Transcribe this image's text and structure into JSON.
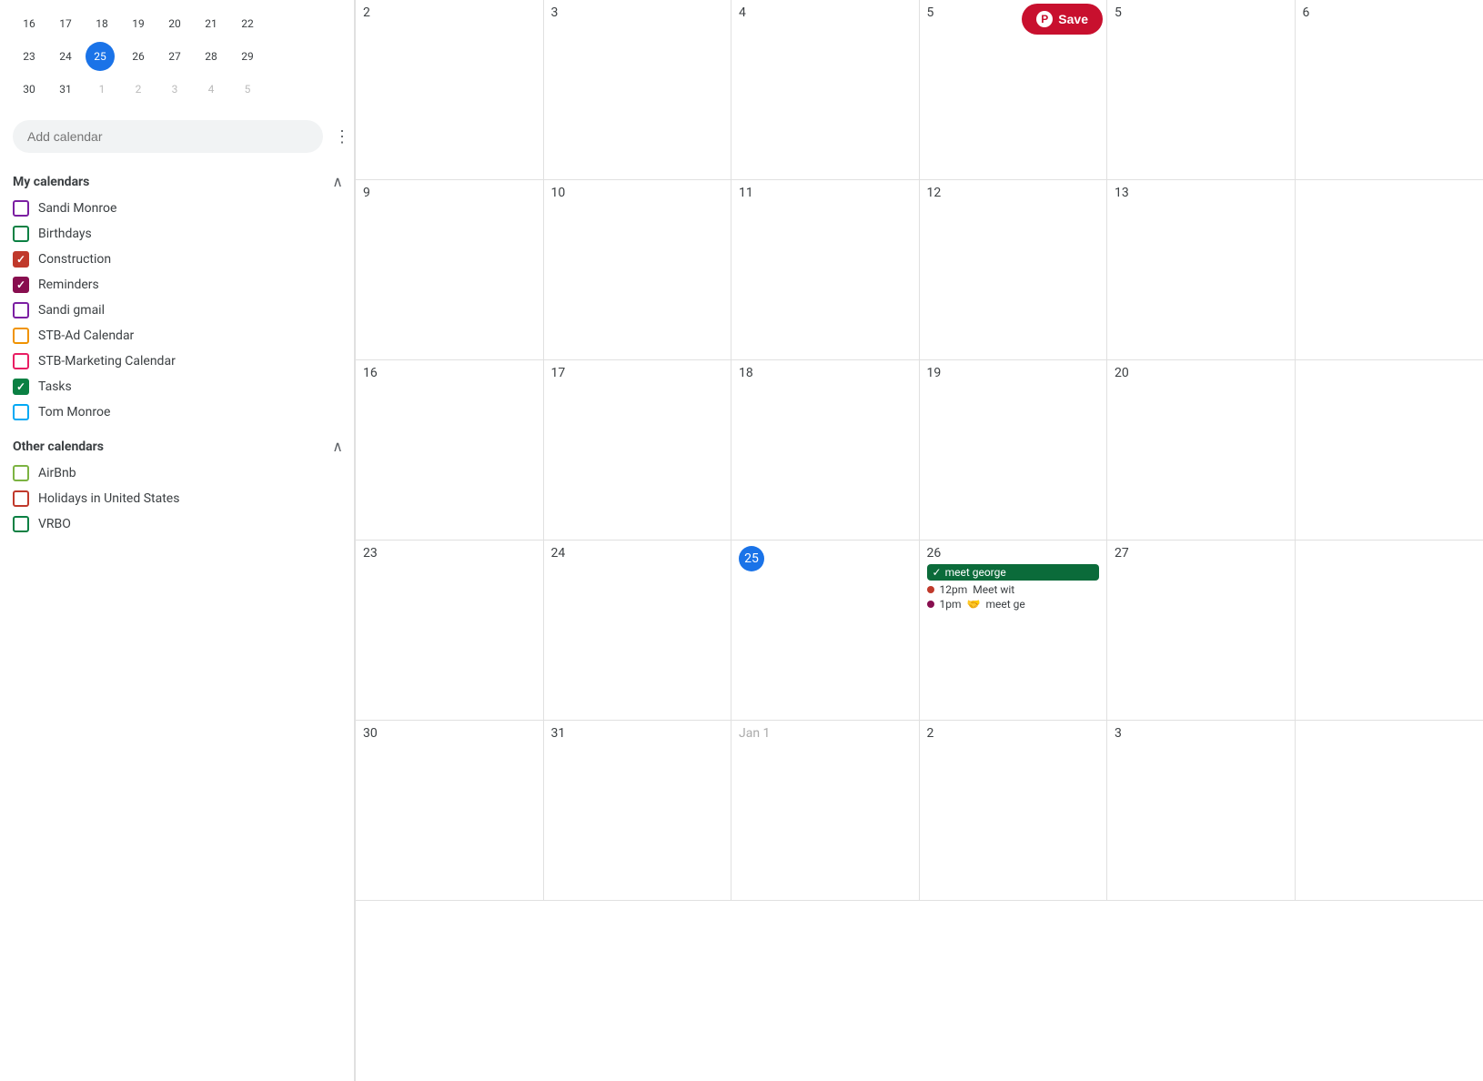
{
  "sidebar": {
    "mini_calendar": {
      "rows": [
        [
          {
            "date": "16",
            "type": "normal"
          },
          {
            "date": "17",
            "type": "normal"
          },
          {
            "date": "18",
            "type": "normal"
          },
          {
            "date": "19",
            "type": "normal"
          },
          {
            "date": "20",
            "type": "normal"
          },
          {
            "date": "21",
            "type": "normal"
          },
          {
            "date": "22",
            "type": "normal"
          }
        ],
        [
          {
            "date": "23",
            "type": "normal"
          },
          {
            "date": "24",
            "type": "normal"
          },
          {
            "date": "25",
            "type": "today"
          },
          {
            "date": "26",
            "type": "normal"
          },
          {
            "date": "27",
            "type": "normal"
          },
          {
            "date": "28",
            "type": "normal"
          },
          {
            "date": "29",
            "type": "normal"
          }
        ],
        [
          {
            "date": "30",
            "type": "normal"
          },
          {
            "date": "31",
            "type": "normal"
          },
          {
            "date": "1",
            "type": "other"
          },
          {
            "date": "2",
            "type": "other"
          },
          {
            "date": "3",
            "type": "other"
          },
          {
            "date": "4",
            "type": "other"
          },
          {
            "date": "5",
            "type": "other"
          }
        ]
      ]
    },
    "add_calendar_placeholder": "Add calendar",
    "my_calendars": {
      "title": "My calendars",
      "items": [
        {
          "label": "Sandi Monroe",
          "checked": false,
          "color": "#7b1fa2"
        },
        {
          "label": "Birthdays",
          "checked": false,
          "color": "#0b8043"
        },
        {
          "label": "Construction",
          "checked": true,
          "color": "#c0392b"
        },
        {
          "label": "Reminders",
          "checked": true,
          "color": "#880e4f"
        },
        {
          "label": "Sandi gmail",
          "checked": false,
          "color": "#7b1fa2"
        },
        {
          "label": "STB-Ad Calendar",
          "checked": false,
          "color": "#f09300"
        },
        {
          "label": "STB-Marketing Calendar",
          "checked": false,
          "color": "#e91e63"
        },
        {
          "label": "Tasks",
          "checked": true,
          "color": "#0b8043"
        },
        {
          "label": "Tom Monroe",
          "checked": false,
          "color": "#03a9f4"
        }
      ]
    },
    "other_calendars": {
      "title": "Other calendars",
      "items": [
        {
          "label": "AirBnb",
          "checked": false,
          "color": "#7cb342"
        },
        {
          "label": "Holidays in United States",
          "checked": false,
          "color": "#c0392b"
        },
        {
          "label": "VRBO",
          "checked": false,
          "color": "#0b8043"
        }
      ]
    }
  },
  "calendar": {
    "save_button_label": "Save",
    "cells": [
      {
        "row": 1,
        "col": 1,
        "date": "2",
        "type": "normal",
        "events": []
      },
      {
        "row": 1,
        "col": 2,
        "date": "3",
        "type": "normal",
        "events": []
      },
      {
        "row": 1,
        "col": 3,
        "date": "4",
        "type": "normal",
        "events": []
      },
      {
        "row": 1,
        "col": 4,
        "date": "5",
        "type": "normal",
        "has_save": true,
        "events": []
      },
      {
        "row": 1,
        "col": 5,
        "date": "5",
        "type": "normal",
        "events": []
      },
      {
        "row": 1,
        "col": 6,
        "date": "6",
        "type": "normal",
        "events": []
      },
      {
        "row": 2,
        "col": 1,
        "date": "9",
        "type": "normal",
        "events": []
      },
      {
        "row": 2,
        "col": 2,
        "date": "10",
        "type": "normal",
        "events": []
      },
      {
        "row": 2,
        "col": 3,
        "date": "11",
        "type": "normal",
        "events": []
      },
      {
        "row": 2,
        "col": 4,
        "date": "12",
        "type": "normal",
        "events": []
      },
      {
        "row": 2,
        "col": 5,
        "date": "13",
        "type": "normal",
        "events": []
      },
      {
        "row": 2,
        "col": 6,
        "date": "",
        "type": "empty",
        "events": []
      },
      {
        "row": 3,
        "col": 1,
        "date": "16",
        "type": "normal",
        "events": []
      },
      {
        "row": 3,
        "col": 2,
        "date": "17",
        "type": "normal",
        "events": []
      },
      {
        "row": 3,
        "col": 3,
        "date": "18",
        "type": "normal",
        "events": []
      },
      {
        "row": 3,
        "col": 4,
        "date": "19",
        "type": "normal",
        "events": []
      },
      {
        "row": 3,
        "col": 5,
        "date": "20",
        "type": "normal",
        "events": []
      },
      {
        "row": 3,
        "col": 6,
        "date": "",
        "type": "empty",
        "events": []
      },
      {
        "row": 4,
        "col": 1,
        "date": "23",
        "type": "normal",
        "events": []
      },
      {
        "row": 4,
        "col": 2,
        "date": "24",
        "type": "normal",
        "events": []
      },
      {
        "row": 4,
        "col": 3,
        "date": "25",
        "type": "today",
        "events": []
      },
      {
        "row": 4,
        "col": 4,
        "date": "26",
        "type": "normal",
        "events": [
          {
            "type": "chip",
            "label": "✓ meet george",
            "color": "#0b6b3a"
          },
          {
            "type": "dot",
            "time": "12pm",
            "label": "Meet wit",
            "color": "#c0392b"
          },
          {
            "type": "dot",
            "time": "1pm",
            "label": "meet ge",
            "color": "#880e4f",
            "icon": "🤝"
          }
        ]
      },
      {
        "row": 4,
        "col": 5,
        "date": "27",
        "type": "normal",
        "events": []
      },
      {
        "row": 4,
        "col": 6,
        "date": "",
        "type": "empty",
        "events": []
      },
      {
        "row": 5,
        "col": 1,
        "date": "30",
        "type": "normal",
        "events": []
      },
      {
        "row": 5,
        "col": 2,
        "date": "31",
        "type": "normal",
        "events": []
      },
      {
        "row": 5,
        "col": 3,
        "date": "Jan 1",
        "type": "other-month",
        "events": []
      },
      {
        "row": 5,
        "col": 4,
        "date": "2",
        "type": "normal",
        "events": []
      },
      {
        "row": 5,
        "col": 5,
        "date": "3",
        "type": "normal",
        "events": []
      },
      {
        "row": 5,
        "col": 6,
        "date": "",
        "type": "empty",
        "events": []
      }
    ]
  }
}
